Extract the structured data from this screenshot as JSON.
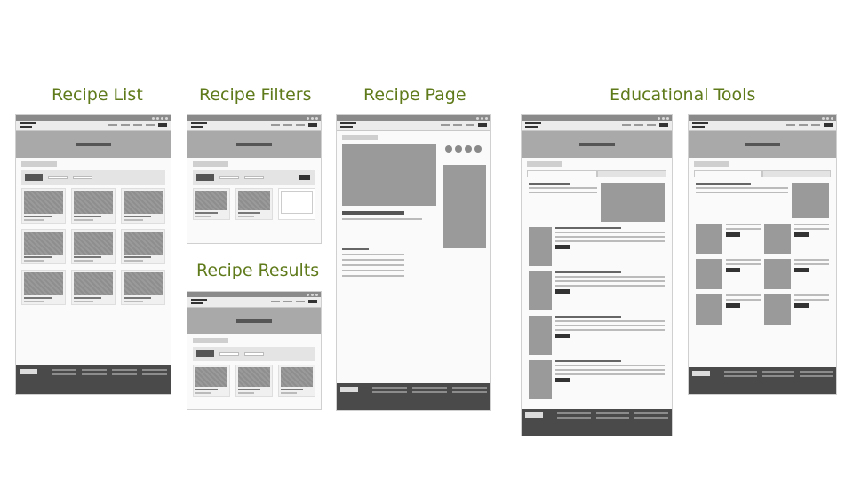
{
  "sections": {
    "recipe_list": "Recipe List",
    "recipe_filters": "Recipe Filters",
    "recipe_page": "Recipe Page",
    "educational_tools": "Educational Tools",
    "recipe_results": "Recipe Results"
  }
}
